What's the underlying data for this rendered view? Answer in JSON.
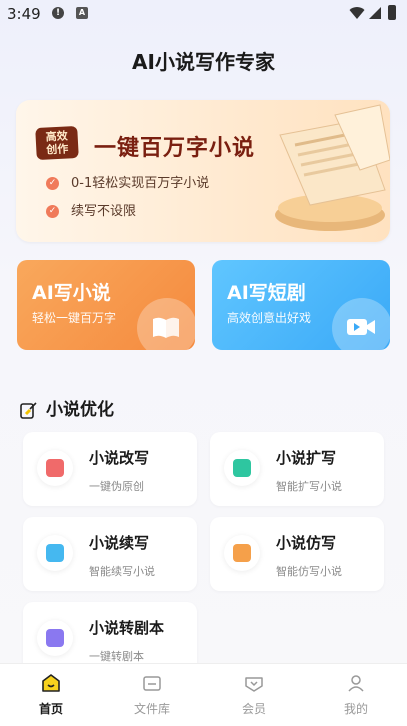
{
  "status": {
    "time": "3:49",
    "icon1": "!",
    "icon2": "A"
  },
  "page_title": "AI小说写作专家",
  "hero": {
    "badge": "高效\n创作",
    "headline": "一键百万字小说",
    "points": [
      "0-1轻松实现百万字小说",
      "续写不设限"
    ]
  },
  "cards": [
    {
      "title": "AI写小说",
      "subtitle": "轻松一键百万字",
      "icon": "book-icon",
      "color": "#f58a3e"
    },
    {
      "title": "AI写短剧",
      "subtitle": "高效创意出好戏",
      "icon": "video-camera-icon",
      "color": "#3aa9f7"
    }
  ],
  "section": {
    "title": "小说优化"
  },
  "features": [
    {
      "title": "小说改写",
      "subtitle": "一键伪原创",
      "icon": "rewrite-icon",
      "color": "#f06a6a"
    },
    {
      "title": "小说扩写",
      "subtitle": "智能扩写小说",
      "icon": "expand-text-icon",
      "color": "#2ec6a0"
    },
    {
      "title": "小说续写",
      "subtitle": "智能续写小说",
      "icon": "continue-write-icon",
      "color": "#45b8f0"
    },
    {
      "title": "小说仿写",
      "subtitle": "智能仿写小说",
      "icon": "imitate-icon",
      "color": "#f5a04a"
    },
    {
      "title": "小说转剧本",
      "subtitle": "一键转剧本",
      "icon": "script-icon",
      "color": "#8a78f0"
    }
  ],
  "tabs": [
    {
      "label": "首页",
      "icon": "home-icon",
      "active": true
    },
    {
      "label": "文件库",
      "icon": "folder-icon",
      "active": false
    },
    {
      "label": "会员",
      "icon": "vip-icon",
      "active": false
    },
    {
      "label": "我的",
      "icon": "profile-icon",
      "active": false
    }
  ]
}
